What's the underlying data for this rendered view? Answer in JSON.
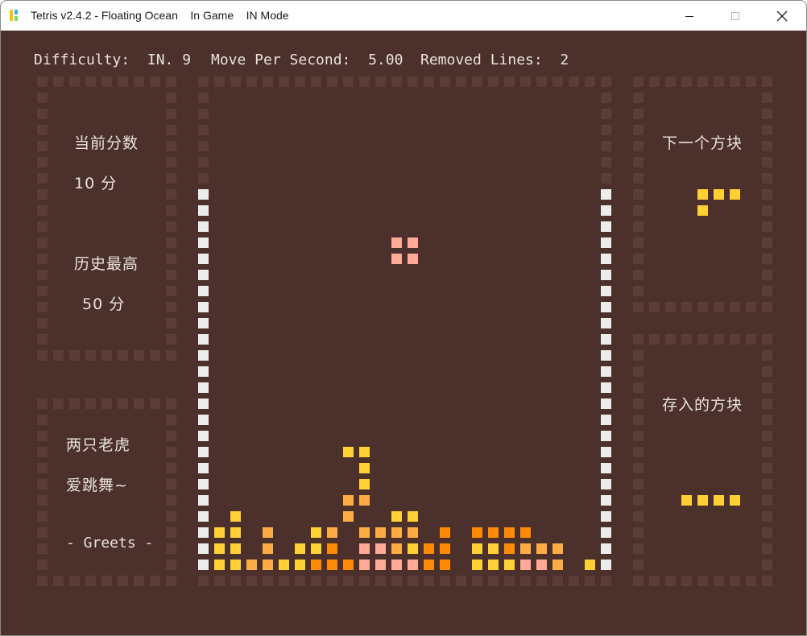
{
  "window": {
    "title": "Tetris v2.4.2 - Floating Ocean    In Game    IN Mode",
    "minimize_icon": "minimize-icon",
    "maximize_icon": "maximize-icon",
    "close_icon": "close-icon"
  },
  "status": {
    "difficulty": "Difficulty:  IN. 9",
    "speed": "Move Per Second:  5.00",
    "removed": "Removed Lines:  2"
  },
  "score_panel": {
    "current_label": "当前分数",
    "current_value": "10 分",
    "best_label": "历史最高",
    "best_value": "50 分"
  },
  "message_panel": {
    "line1": "两只老虎",
    "line2": "爱跳舞~",
    "greets": "- Greets -"
  },
  "next_panel": {
    "label": "下一个方块",
    "piece": [
      "###",
      "#.."
    ]
  },
  "hold_panel": {
    "label": "存入的方块",
    "piece": [
      "####"
    ]
  },
  "board": {
    "falling_piece": [
      "S",
      "O",
      "..SS..",
      "..SS.."
    ],
    "rows": [
      "...............",
      "...............",
      "...............",
      "...............",
      "...............",
      "...............",
      "...............",
      "...............",
      "...............",
      "...............",
      "...............",
      "...............",
      "...............",
      "...............",
      "...............",
      "...............",
      "........YY.....",
      ".........Y.....",
      ".........Y.....",
      "........AA.....",
      ".Y......A..YY..",
      "YY.A..YA.AAAA.O.OOOO",
      "YY.A.YYO.SSAYOO.YYOAAA",
      "YYAAYYOOOSSSSOO.YYYSSA.Y"
    ]
  },
  "colors": {
    "background": "#4b302c",
    "frame_dim": "#5c3c37",
    "wall": "#ececec",
    "yellow": "#ffd034",
    "amber": "#ffac45",
    "orange": "#ff8a05",
    "salmon": "#ffa996",
    "text": "#e9e3d8"
  }
}
